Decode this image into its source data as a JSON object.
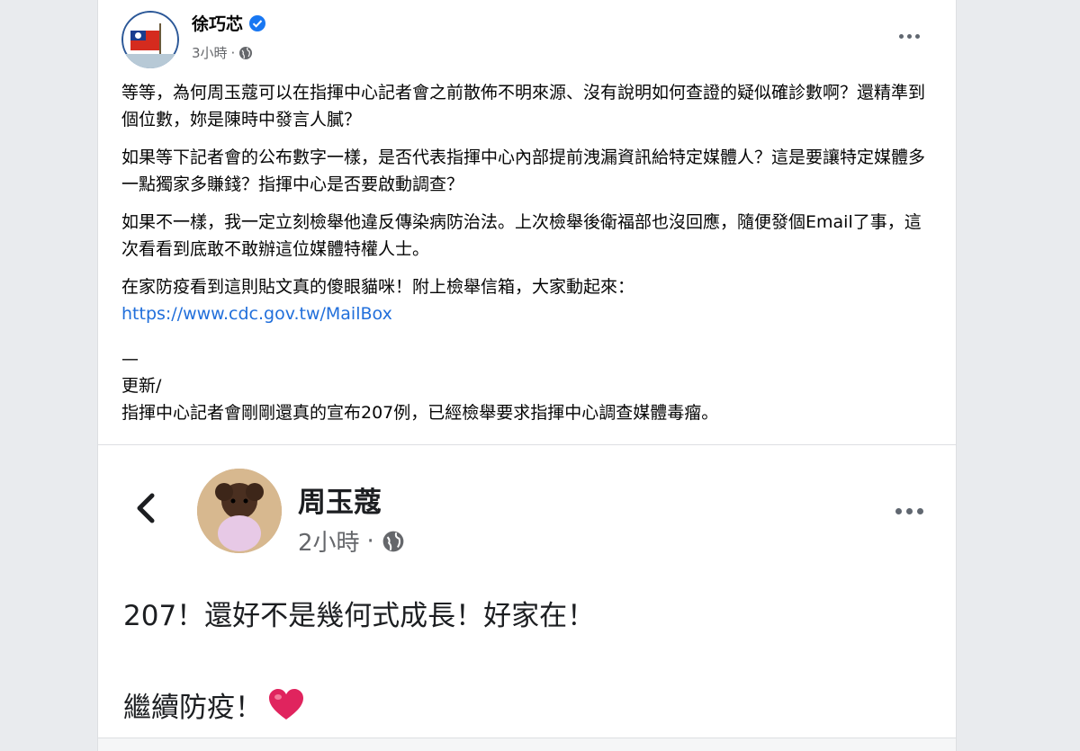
{
  "post": {
    "author": "徐巧芯",
    "time": "3小時",
    "separator": "·",
    "paragraphs": [
      "等等，為何周玉蔻可以在指揮中心記者會之前散佈不明來源、沒有說明如何查證的疑似確診數啊？還精準到個位數，妳是陳時中發言人膩？",
      "如果等下記者會的公布數字一樣，是否代表指揮中心內部提前洩漏資訊給特定媒體人？這是要讓特定媒體多一點獨家多賺錢？指揮中心是否要啟動調查？",
      "如果不一樣，我一定立刻檢舉他違反傳染病防治法。上次檢舉後衛福部也沒回應，隨便發個Email了事，這次看看到底敢不敢辦這位媒體特權人士。",
      "在家防疫看到這則貼文真的傻眼貓咪！附上檢舉信箱，大家動起來："
    ],
    "link": "https://www.cdc.gov.tw/MailBox",
    "dash": "—",
    "update_label": "更新/",
    "update_text": "指揮中心記者會剛剛還真的宣布207例，已經檢舉要求指揮中心調查媒體毒瘤。"
  },
  "embedded": {
    "author": "周玉蔻",
    "time": "2小時",
    "separator": "·",
    "line1": "207！還好不是幾何式成長！好家在！",
    "line2": "繼續防疫！",
    "heart": "❤️"
  },
  "colors": {
    "link": "#216fdb",
    "verified": "#1877f2",
    "heart": "#e0245e"
  }
}
